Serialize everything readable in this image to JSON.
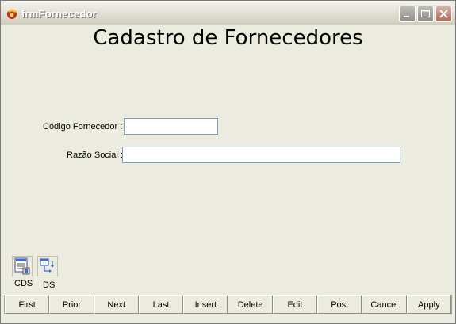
{
  "window": {
    "title": "frmFornecedor"
  },
  "form": {
    "heading": "Cadastro de Fornecedores",
    "codigo_label": "Código Fornecedor :",
    "codigo_value": "",
    "razao_label": "Razão Social :",
    "razao_value": ""
  },
  "components": {
    "cds_label": "CDS",
    "ds_label": "DS"
  },
  "navigator": {
    "buttons": [
      "First",
      "Prior",
      "Next",
      "Last",
      "Insert",
      "Delete",
      "Edit",
      "Post",
      "Cancel",
      "Apply"
    ]
  }
}
